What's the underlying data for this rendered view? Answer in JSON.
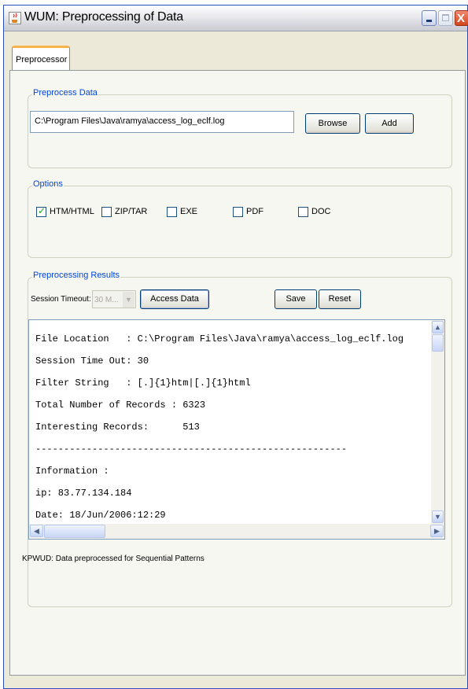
{
  "window": {
    "title": "WUM: Preprocessing of Data",
    "app_icon": "java-cup-icon",
    "controls": {
      "minimize_icon": "minimize-icon",
      "maximize_icon": "maximize-icon",
      "close_icon": "close-icon",
      "close_glyph": "X"
    }
  },
  "tabs": [
    {
      "label": "Preprocessor",
      "selected": true
    }
  ],
  "preprocess": {
    "group_title": "Preprocess Data",
    "file_path": "C:\\Program Files\\Java\\ramya\\access_log_eclf.log",
    "browse_label": "Browse",
    "add_label": "Add"
  },
  "options": {
    "group_title": "Options",
    "checkboxes": [
      {
        "label": "HTM/HTML",
        "checked": true
      },
      {
        "label": "ZIP/TAR",
        "checked": false
      },
      {
        "label": "EXE",
        "checked": false
      },
      {
        "label": "PDF",
        "checked": false
      },
      {
        "label": "DOC",
        "checked": false
      }
    ]
  },
  "results": {
    "group_title": "Preprocessing Results",
    "session_timeout_label": "Session Timeout:",
    "session_timeout_value": "30 M...",
    "access_data_label": "Access Data",
    "save_label": "Save",
    "reset_label": "Reset",
    "output_lines": [
      "File Location   : C:\\Program Files\\Java\\ramya\\access_log_eclf.log",
      "Session Time Out: 30",
      "Filter String   : [.]{1}htm|[.]{1}html",
      "Total Number of Records : 6323",
      "Interesting Records:      513",
      "-------------------------------------------------------",
      "Information :",
      "ip: 83.77.134.184",
      "Date: 18/Jun/2006:12:29"
    ],
    "status_text": "KPWUD: Data preprocessed for Sequential Patterns"
  },
  "colors": {
    "group_title": "#0046d5",
    "tab_highlight": "#f5b34a",
    "checkbox_check": "#21a121"
  }
}
